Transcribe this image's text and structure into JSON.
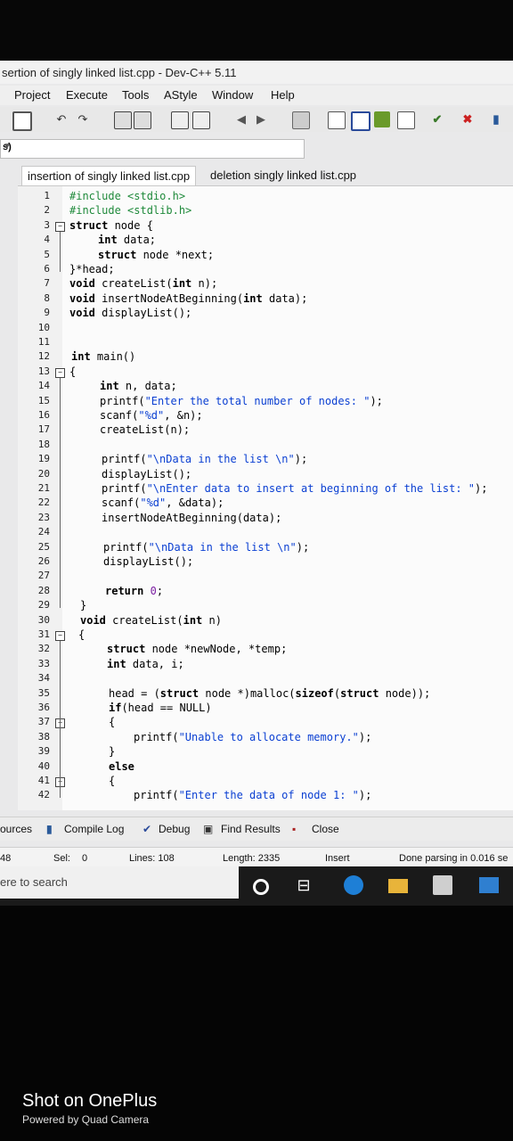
{
  "window": {
    "title": "sertion of singly linked list.cpp - Dev-C++ 5.11"
  },
  "menu": [
    "Project",
    "Execute",
    "Tools",
    "AStyle",
    "Window",
    "Help"
  ],
  "class_combo": {
    "value": "s)"
  },
  "tabs": [
    {
      "label": "insertion of singly linked list.cpp",
      "active": true
    },
    {
      "label": "deletion singly linked list.cpp",
      "active": false
    }
  ],
  "line_numbers": [
    "1",
    "2",
    "3",
    "4",
    "5",
    "6",
    "7",
    "8",
    "9",
    "10",
    "11",
    "12",
    "13",
    "14",
    "15",
    "16",
    "17",
    "18",
    "19",
    "20",
    "21",
    "22",
    "23",
    "24",
    "25",
    "26",
    "27",
    "28",
    "29",
    "30",
    "31",
    "32",
    "33",
    "34",
    "35",
    "36",
    "37",
    "38",
    "39",
    "40",
    "41",
    "42"
  ],
  "code_lines": [
    "#include <stdio.h>",
    "#include <stdlib.h>",
    "struct node {",
    "int data;",
    "struct node *next;",
    "}*head;",
    "void createList(int n);",
    "void insertNodeAtBeginning(int data);",
    "void displayList();",
    "",
    "",
    "int main()",
    "{",
    "int n, data;",
    "printf(\"Enter the total number of nodes: \");",
    "scanf(\"%d\", &n);",
    "createList(n);",
    "",
    "printf(\"\\nData in the list \\n\");",
    "displayList();",
    "printf(\"\\nEnter data to insert at beginning of the list: \");",
    "scanf(\"%d\", &data);",
    "insertNodeAtBeginning(data);",
    "",
    "printf(\"\\nData in the list \\n\");",
    "displayList();",
    "",
    "return 0;",
    "}",
    "void createList(int n)",
    "{",
    "struct node *newNode, *temp;",
    "int data, i;",
    "",
    "head = (struct node *)malloc(sizeof(struct node));",
    "if(head == NULL)",
    "{",
    "printf(\"Unable to allocate memory.\");",
    "}",
    "else",
    "{",
    "printf(\"Enter the data of node 1: \");"
  ],
  "bottom_tabs": [
    "ources",
    "Compile Log",
    "Debug",
    "Find Results",
    "Close"
  ],
  "status": {
    "line": "48",
    "sel_label": "Sel:",
    "sel_value": "0",
    "lines": "Lines: 108",
    "length": "Length: 2335",
    "mode": "Insert",
    "message": "Done parsing in 0.016 se"
  },
  "taskbar": {
    "search_placeholder": "ere to search",
    "icons": [
      "cortana-icon",
      "task-view-icon",
      "edge-icon",
      "file-explorer-icon",
      "store-icon",
      "mail-icon"
    ]
  },
  "watermark": {
    "line1": "Shot on OnePlus",
    "line2": "Powered by Quad Camera"
  },
  "colors": {
    "preprocessor": "#1f8a3b",
    "string": "#0a3fd2",
    "number": "#7b1fa2"
  }
}
